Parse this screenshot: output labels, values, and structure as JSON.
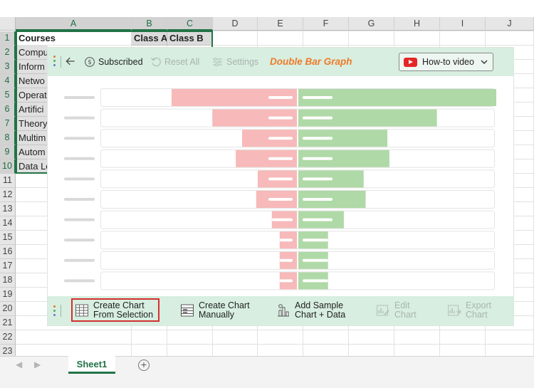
{
  "sheet": {
    "columns": [
      "A",
      "B",
      "C",
      "D",
      "E",
      "F",
      "G",
      "H",
      "I",
      "J"
    ],
    "rows": [
      "1",
      "2",
      "3",
      "4",
      "5",
      "6",
      "7",
      "8",
      "9",
      "10",
      "11",
      "12",
      "13",
      "14",
      "15",
      "16",
      "17",
      "18",
      "19",
      "20",
      "21",
      "22",
      "23"
    ],
    "cells": {
      "headers": [
        "Courses",
        "Class A",
        "Class B"
      ],
      "courses": [
        "Compu",
        "Inform",
        "Netwo",
        "Operat",
        "Artifici",
        "Theory",
        "Multim",
        "Autom",
        "Data Lo"
      ]
    }
  },
  "tabs": {
    "active": "Sheet1",
    "add_icon": "plus-circle-icon",
    "prev_icon": "caret-left-icon",
    "next_icon": "caret-right-icon"
  },
  "panel": {
    "toolbar": {
      "back_icon": "arrow-left-icon",
      "subscribed_label": "Subscribed",
      "reset_label": "Reset All",
      "settings_label": "Settings",
      "title": "Double Bar Graph",
      "howto_label": "How-to video"
    },
    "actions": {
      "create_from_selection": [
        "Create Chart",
        "From Selection"
      ],
      "create_manually": [
        "Create Chart",
        "Manually"
      ],
      "add_sample": [
        "Add Sample",
        "Chart + Data"
      ],
      "edit_chart": [
        "Edit",
        "Chart"
      ],
      "export_chart": [
        "Export",
        "Chart"
      ]
    },
    "colors": {
      "panel_bg": "#d7eee0",
      "accent_title": "#f07a2a",
      "class_a": "#f7b9b9",
      "class_b": "#afd9a7",
      "highlight": "#d3302f",
      "excel_green": "#217346"
    }
  },
  "chart_data": {
    "type": "bar",
    "layout": "diverging-double-bar",
    "series": [
      {
        "values": [
          0.8,
          0.54,
          0.35,
          0.39,
          0.25,
          0.26,
          0.16,
          0.11,
          0.11,
          0.11
        ]
      },
      {
        "values": [
          1.0,
          0.7,
          0.45,
          0.46,
          0.33,
          0.34,
          0.23,
          0.15,
          0.15,
          0.15
        ]
      }
    ]
  }
}
